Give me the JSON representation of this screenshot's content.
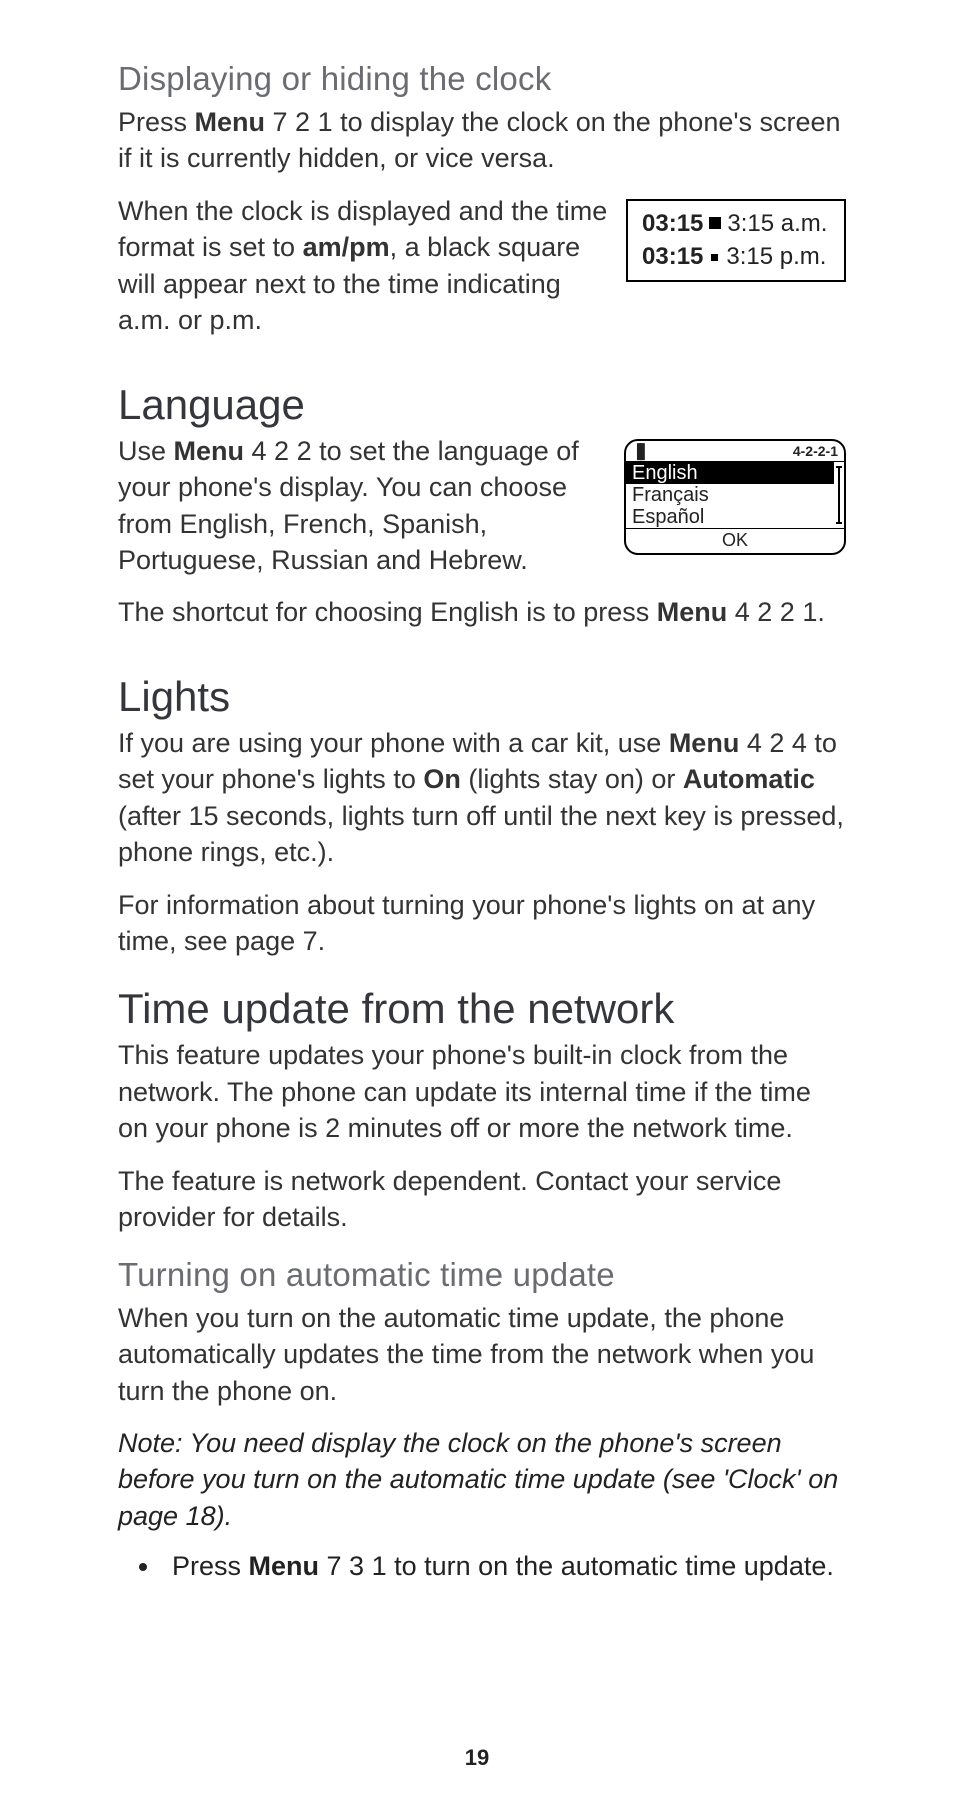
{
  "page_number": "19",
  "sections": {
    "clock": {
      "heading": "Displaying or hiding the clock",
      "p1_a": "Press ",
      "p1_menu": "Menu",
      "p1_b": " 7 2 1 to display the clock on the phone's screen if it is currently hidden, or vice versa.",
      "p2_a": "When the clock is displayed and the time format is set to ",
      "p2_b_ampm": "am/pm",
      "p2_c": ", a black square will appear next to the time indicating a.m. or p.m."
    },
    "time_box": {
      "row1_bold": "03:15",
      "row1_rest": "3:15 a.m.",
      "row2_bold": "03:15",
      "row2_rest": "3:15 p.m."
    },
    "language": {
      "heading": "Language",
      "p1_a": "Use ",
      "p1_menu": "Menu",
      "p1_b": " 4 2 2 to set the language of your phone's display. You can choose from English, French, Spanish, Portuguese, Russian and Hebrew.",
      "p2_a": "The shortcut for choosing English is to press ",
      "p2_menu": "Menu",
      "p2_b": " 4 2 2 1."
    },
    "phone_screen": {
      "menu_path": "4-2-2-1",
      "items": [
        "English",
        "Français",
        "Español"
      ],
      "selected_index": 0,
      "softkey": "OK"
    },
    "lights": {
      "heading": "Lights",
      "p1_a": "If you are using your phone with a car kit, use ",
      "p1_menu": "Menu",
      "p1_b": " 4 2 4 to set your phone's lights to ",
      "p1_on": "On",
      "p1_c": " (lights stay on) or ",
      "p1_auto": "Automatic",
      "p1_d": " (after 15 seconds, lights turn off until the next key is pressed, phone rings, etc.).",
      "p2": "For information about turning your phone's lights on at any time, see page 7."
    },
    "time_update": {
      "heading": "Time update from the network",
      "p1": "This feature updates your phone's built-in clock from the network. The phone can update its internal time if the time on your phone is 2 minutes off or more the network time.",
      "p2": "The feature is network dependent. Contact your service provider for details.",
      "sub_heading": "Turning on automatic time update",
      "p3": "When you turn on the automatic time update, the phone automatically updates the time from the network when you turn the phone on.",
      "note": "Note: You need display the clock on the phone's screen before you turn on the automatic time update  (see 'Clock' on page 18).",
      "bullet_a": "Press ",
      "bullet_menu": "Menu",
      "bullet_b": " 7 3 1 to turn on the automatic time update."
    }
  }
}
